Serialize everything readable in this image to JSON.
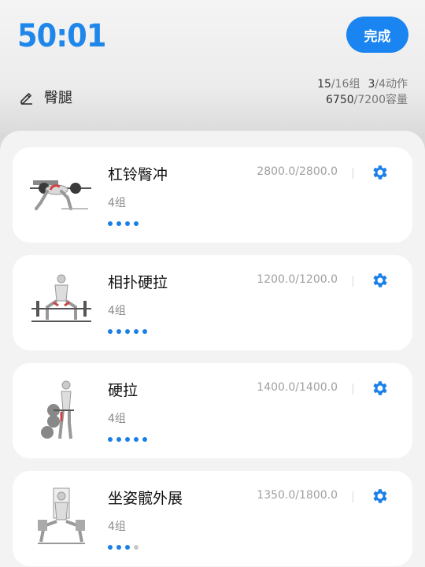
{
  "header": {
    "timer": "50:01",
    "done_label": "完成",
    "routine_name": "臀腿",
    "edit_icon": "pencil-icon",
    "stats": {
      "sets_done": "15",
      "sets_total": "/16组",
      "actions_done": "3",
      "actions_total": "/4动作",
      "volume_done": "6750",
      "volume_total": "/7200容量"
    }
  },
  "accent_color": "#1a84f0",
  "exercises": [
    {
      "name": "杠铃臀冲",
      "sets": "4组",
      "volume": "2800.0/2800.0",
      "completed_sets": 4,
      "total_sets": 4,
      "image": "barbell-hip-thrust-illustration"
    },
    {
      "name": "相扑硬拉",
      "sets": "4组",
      "volume": "1200.0/1200.0",
      "completed_sets": 5,
      "total_sets": 5,
      "image": "sumo-deadlift-illustration"
    },
    {
      "name": "硬拉",
      "sets": "4组",
      "volume": "1400.0/1400.0",
      "completed_sets": 5,
      "total_sets": 5,
      "image": "deadlift-illustration"
    },
    {
      "name": "坐姿髋外展",
      "sets": "4组",
      "volume": "1350.0/1800.0",
      "completed_sets": 3,
      "total_sets": 4,
      "image": "seated-hip-abduction-illustration"
    }
  ]
}
